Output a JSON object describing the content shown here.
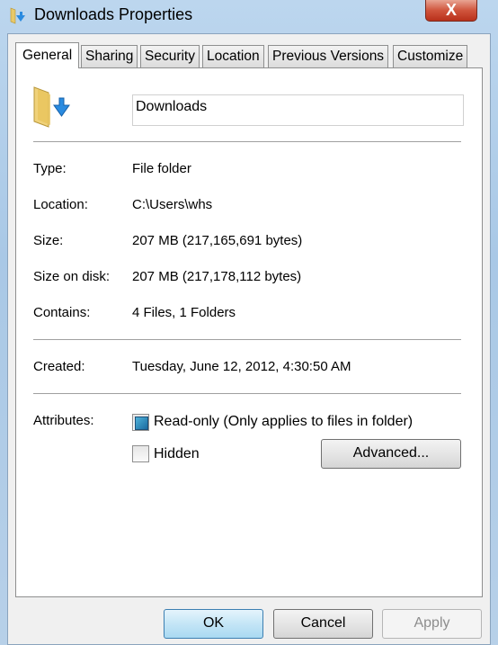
{
  "window": {
    "title": "Downloads Properties",
    "close_label": "X"
  },
  "tabs": [
    {
      "label": "General"
    },
    {
      "label": "Sharing"
    },
    {
      "label": "Security"
    },
    {
      "label": "Location"
    },
    {
      "label": "Previous Versions"
    },
    {
      "label": "Customize"
    }
  ],
  "active_tab": "General",
  "general": {
    "folder_name": "Downloads",
    "icon": "downloads-folder-icon",
    "rows": [
      {
        "label": "Type:",
        "value": "File folder"
      },
      {
        "label": "Location:",
        "value": "C:\\Users\\whs"
      },
      {
        "label": "Size:",
        "value": "207 MB (217,165,691 bytes)"
      },
      {
        "label": "Size on disk:",
        "value": "207 MB (217,178,112 bytes)"
      },
      {
        "label": "Contains:",
        "value": "4 Files, 1 Folders"
      }
    ],
    "created": {
      "label": "Created:",
      "value": "Tuesday, June 12, 2012, 4:30:50 AM"
    },
    "attributes": {
      "label": "Attributes:",
      "readonly_label": "Read-only (Only applies to files in folder)",
      "readonly_state": "indeterminate",
      "hidden_label": "Hidden",
      "hidden_state": "unchecked",
      "advanced_label": "Advanced..."
    }
  },
  "buttons": {
    "ok": "OK",
    "cancel": "Cancel",
    "apply": "Apply",
    "apply_enabled": false
  }
}
